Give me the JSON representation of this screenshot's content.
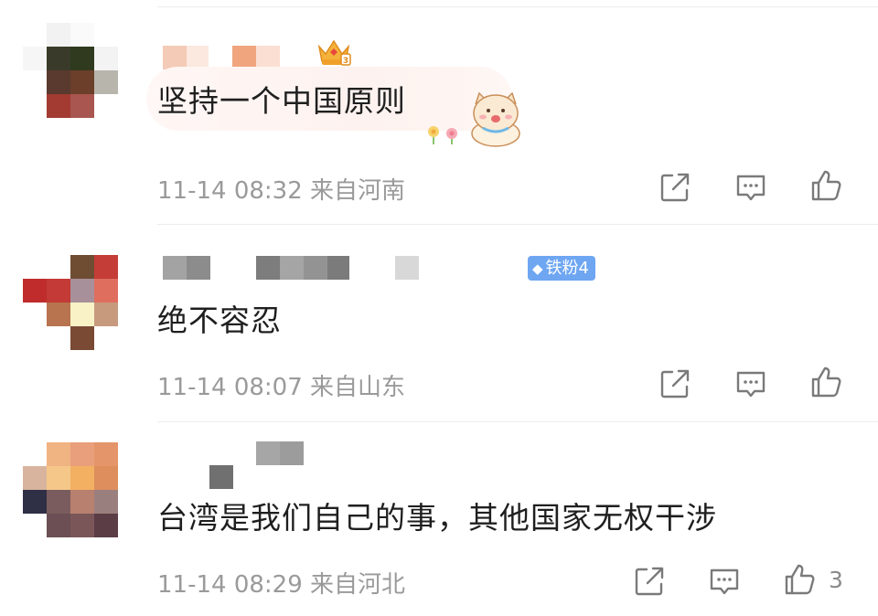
{
  "comments": [
    {
      "text": "坚持一个中国原则",
      "meta": "11-14 08:32 来自河南",
      "like_count": ""
    },
    {
      "text": "绝不容忍",
      "meta": "11-14 08:07 来自山东",
      "fan_badge": "铁粉4",
      "like_count": ""
    },
    {
      "text": "台湾是我们自己的事，其他国家无权干涉",
      "meta": "11-14 08:29 来自河北",
      "like_count": "3"
    }
  ],
  "icons": {
    "share": "share-icon",
    "reply": "comment-icon",
    "like": "thumbs-up-icon",
    "crown": "crown-badge-icon",
    "sticker": "cat-sticker-icon"
  },
  "colors": {
    "text": "#1f1f1f",
    "meta": "#9a9a9a",
    "icon": "#7a7a7a",
    "badge": "#6ea6f2",
    "divider": "#ececec"
  }
}
